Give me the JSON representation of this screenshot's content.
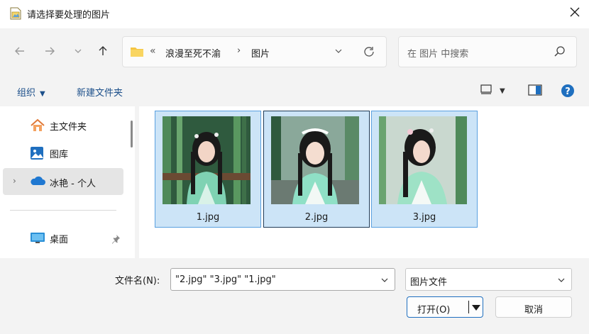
{
  "window": {
    "title": "请选择要处理的图片",
    "icon": "image-file-icon"
  },
  "nav": {
    "back_icon": "arrow-left-icon",
    "forward_icon": "arrow-right-icon",
    "recent_icon": "chevron-down-icon",
    "up_icon": "arrow-up-icon",
    "overflow": "«",
    "breadcrumbs": [
      "浪漫至死不渝",
      "图片"
    ],
    "search_placeholder": "在 图片 中搜索"
  },
  "toolbar": {
    "organize": "组织",
    "new_folder": "新建文件夹"
  },
  "sidebar": {
    "items": [
      {
        "label": "主文件夹",
        "icon": "home-icon"
      },
      {
        "label": "图库",
        "icon": "gallery-icon"
      },
      {
        "label": "冰艳 - 个人",
        "icon": "onedrive-cloud-icon"
      },
      {
        "label": "桌面",
        "icon": "desktop-icon"
      }
    ]
  },
  "files": [
    {
      "name": "1.jpg"
    },
    {
      "name": "2.jpg"
    },
    {
      "name": "3.jpg"
    }
  ],
  "footer": {
    "filename_label": "文件名(N):",
    "filename_value": "\"2.jpg\" \"3.jpg\" \"1.jpg\"",
    "filetype_value": "图片文件",
    "open_label": "打开(O)",
    "cancel_label": "取消"
  },
  "colors": {
    "accent": "#1f6fbf",
    "selection": "#cce4f7",
    "selection_border": "#5aa0e0"
  }
}
